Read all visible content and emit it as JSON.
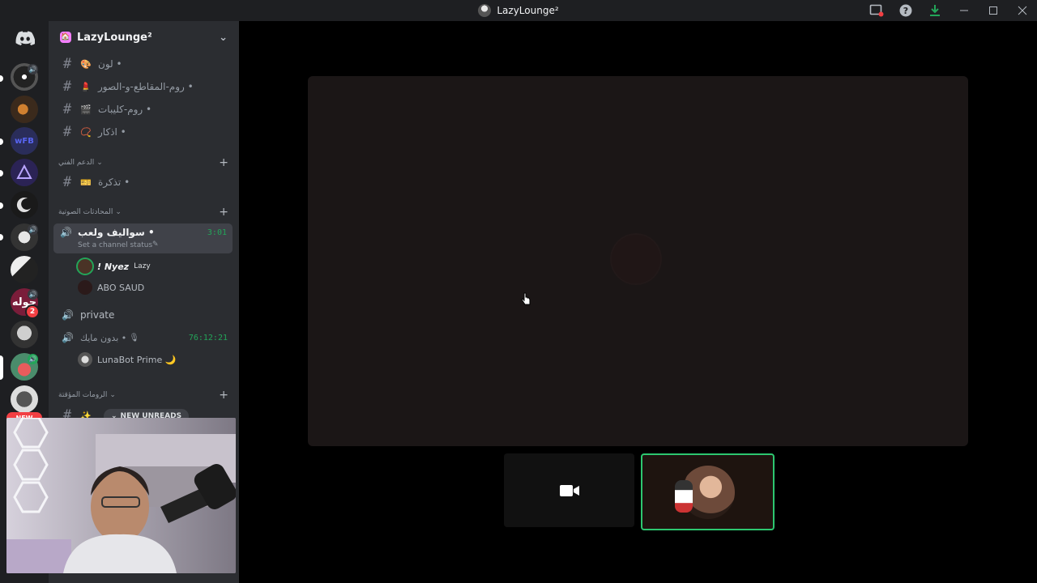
{
  "window": {
    "title": "LazyLounge²"
  },
  "server": {
    "name": "LazyLounge²"
  },
  "guilds": {
    "mention_count": "2",
    "new_label": "NEW"
  },
  "channels": [
    {
      "name": "لون •",
      "emoji": "🎨"
    },
    {
      "name": "روم-المقاطع-و-الصور •",
      "emoji": "💄"
    },
    {
      "name": "روم-كليبات •",
      "emoji": "🎬"
    },
    {
      "name": "اذكار •",
      "emoji": "📿"
    }
  ],
  "categories": {
    "support": "الدعم الفني",
    "voice": "المحادثات الصوتية",
    "temp": "الرومات المؤقتة"
  },
  "support_channel": {
    "name": "تذكرة •",
    "emoji": "🎫"
  },
  "voice_active": {
    "name": "سواليف ولعب •",
    "time": "3:01",
    "status": "Set a channel status"
  },
  "voice_users": [
    {
      "name": "! Nyez",
      "tag": "Lazy"
    },
    {
      "name": "ABO SAUD"
    }
  ],
  "voice_private": {
    "name": "private"
  },
  "voice_nomic": {
    "name": "بدون مايك •",
    "time": "76:12:21"
  },
  "voice_bot": {
    "name": "LunaBot Prime 🌙"
  },
  "new_unreads": "NEW UNREADS"
}
